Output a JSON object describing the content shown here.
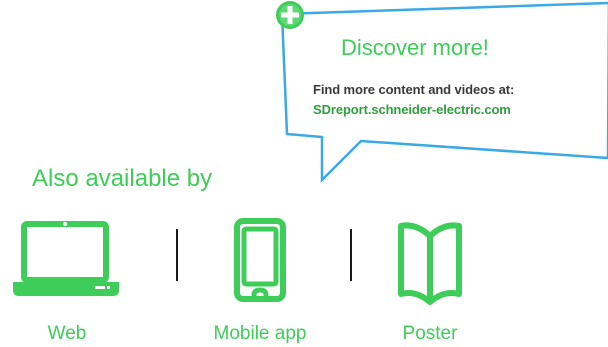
{
  "callout": {
    "title": "Discover more!",
    "line1": "Find more content and videos at:",
    "link": "SDreport.schneider-electric.com",
    "icon": "plus-circle-icon"
  },
  "also_available": {
    "heading": "Also available by",
    "channels": [
      {
        "label": "Web",
        "icon": "laptop-icon"
      },
      {
        "label": "Mobile app",
        "icon": "mobile-phone-icon"
      },
      {
        "label": "Poster",
        "icon": "open-book-icon"
      }
    ]
  },
  "colors": {
    "brand_green": "#3dcd58",
    "link_green": "#2f9e3f",
    "callout_border": "#3aa9e6",
    "text_dark": "#3a3a3a"
  }
}
